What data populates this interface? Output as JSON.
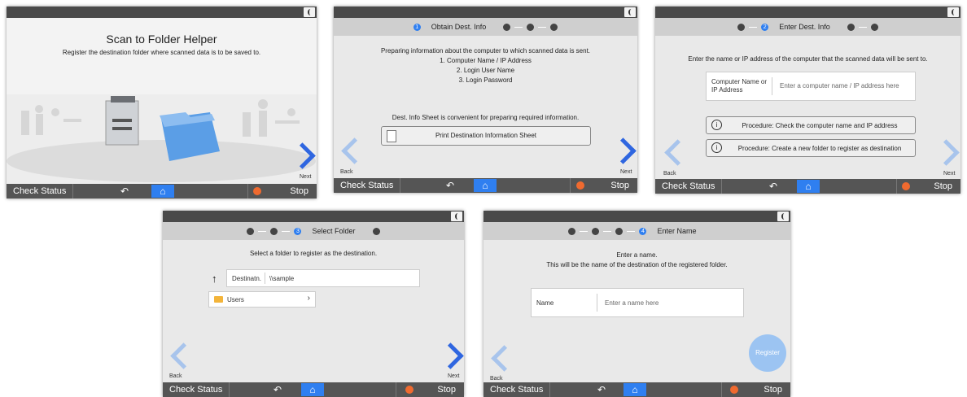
{
  "common": {
    "check_status": "Check Status",
    "stop": "Stop",
    "back": "Back",
    "next": "Next",
    "back_glyph": "↶",
    "home_glyph": "⌂"
  },
  "screen1": {
    "title": "Scan to Folder Helper",
    "subtitle": "Register the destination folder where scanned data is to be saved to."
  },
  "screen2": {
    "step_label": "Obtain Dest. Info",
    "step_num": "1",
    "lines": [
      "Preparing information about the computer to which scanned data is sent.",
      "1. Computer Name / IP Address",
      "2. Login User Name",
      "3. Login Password"
    ],
    "sheet_note": "Dest. Info Sheet is convenient for preparing required information.",
    "print_button": "Print Destination Information Sheet"
  },
  "screen3": {
    "step_label": "Enter Dest. Info",
    "step_num": "2",
    "instruction": "Enter the name or IP address of the computer that the scanned data will be sent to.",
    "field_label": "Computer Name or IP Address",
    "field_placeholder": "Enter a computer name / IP address here",
    "procedure1": "Procedure: Check the computer name and IP address",
    "procedure2": "Procedure: Create a new folder to register as destination"
  },
  "screen4": {
    "step_label": "Select Folder",
    "step_num": "3",
    "instruction": "Select a folder to register as the destination.",
    "dest_label": "Destinatn.",
    "dest_value": "\\\\sample",
    "folder_item": "Users"
  },
  "screen5": {
    "step_label": "Enter Name",
    "step_num": "4",
    "line1": "Enter a name.",
    "line2": "This will be the name of the destination of the registered folder.",
    "name_label": "Name",
    "name_placeholder": "Enter a name here",
    "register_button": "Register"
  },
  "colors": {
    "accent": "#2f7ff0",
    "stop_icon": "#f06a2f",
    "topbar": "#4a4a4a",
    "bottombar": "#555555"
  }
}
